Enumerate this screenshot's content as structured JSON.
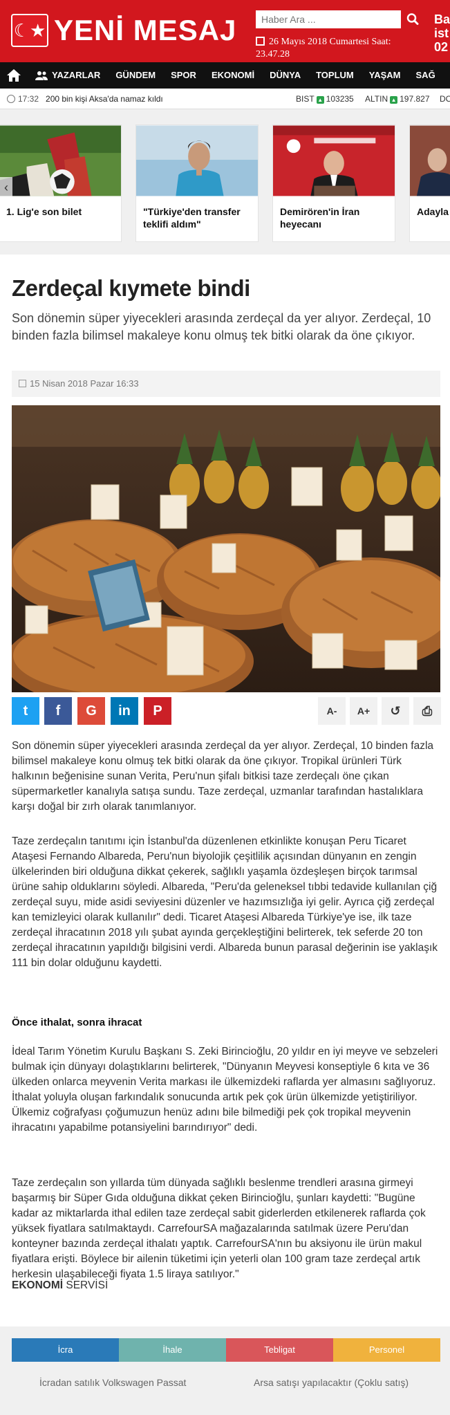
{
  "header": {
    "logo_text": "YENİ MESAJ",
    "search_placeholder": "Haber Ara ...",
    "date": "26 Mayıs 2018 Cumartesi Saat: 23.47.28",
    "weather_top": "Ba",
    "weather_mid": "ist",
    "weather_bot": "02"
  },
  "nav": {
    "items": [
      "YAZARLAR",
      "GÜNDEM",
      "SPOR",
      "EKONOMİ",
      "DÜNYA",
      "TOPLUM",
      "YAŞAM",
      "SAĞ"
    ]
  },
  "ticker": {
    "time": "17:32",
    "headline": "200 bin kişi Aksa'da namaz kıldı",
    "bist_label": "BIST",
    "bist_value": "103235",
    "altin_label": "ALTIN",
    "altin_value": "197.827",
    "dolar_label": "DO"
  },
  "slider": {
    "cards": [
      {
        "caption": "1. Lig'e son bilet"
      },
      {
        "caption": "\"Türkiye'den transfer teklifi aldım\""
      },
      {
        "caption": "Demirören'in İran heyecanı"
      },
      {
        "caption": "Adayla kullan"
      }
    ]
  },
  "article": {
    "title": "Zerdeçal kıymete bindi",
    "lead": "Son dönemin süper yiyecekleri arasında zerdeçal da yer alıyor. Zerdeçal, 10 binden fazla bilimsel makaleye konu olmuş tek bitki olarak da öne çıkıyor.",
    "date": "15 Nisan 2018 Pazar 16:33",
    "share": {
      "twitter": "t",
      "facebook": "f",
      "google": "G",
      "linkedin": "in",
      "pinterest": "P"
    },
    "tools": {
      "font_down": "A-",
      "font_up": "A+",
      "reset": "↺",
      "print": "⎙"
    },
    "p1": "Son dönemin süper yiyecekleri arasında zerdeçal da yer alıyor. Zerdeçal, 10 binden fazla bilimsel makaleye konu olmuş tek bitki olarak da öne çıkıyor. Tropikal ürünleri Türk halkının beğenisine sunan Verita, Peru'nun şifalı bitkisi taze zerdeçalı öne çıkan süpermarketler kanalıyla satışa sundu. Taze zerdeçal, uzmanlar tarafından hastalıklara karşı doğal bir zırh olarak tanımlanıyor.",
    "p2": "Taze zerdeçalın tanıtımı için İstanbul'da düzenlenen etkinlikte konuşan Peru Ticaret Ataşesi Fernando Albareda, Peru'nun biyolojik çeşitlilik açısından dünyanın en zengin ülkelerinden biri olduğuna dikkat çekerek, sağlıklı yaşamla özdeşleşen birçok tarımsal ürüne sahip olduklarını söyledi. Albareda, \"Peru'da geleneksel tıbbi tedavide kullanılan çiğ zerdeçal suyu, mide asidi seviyesini düzenler ve hazımsızlığa iyi gelir. Ayrıca çiğ zerdeçal kan temizleyici olarak kullanılır\" dedi. Ticaret Ataşesi Albareda Türkiye'ye ise, ilk taze zerdeçal ihracatının 2018 yılı şubat ayında gerçekleştiğini belirterek, tek seferde 20 ton zerdeçal ihracatının yapıldığı bilgisini verdi. Albareda bunun parasal değerinin ise yaklaşık 111 bin dolar olduğunu kaydetti.",
    "subheading": "Önce ithalat, sonra ihracat",
    "p3": "İdeal Tarım Yönetim Kurulu Başkanı S. Zeki Birincioğlu, 20 yıldır en iyi meyve ve sebzeleri bulmak için dünyayı dolaştıklarını belirterek, \"Dünyanın Meyvesi konseptiyle 6 kıta ve 36 ülkeden onlarca meyvenin Verita markası ile ülkemizdeki raflarda yer almasını sağlıyoruz. İthalat yoluyla oluşan farkındalık sonucunda artık pek çok ürün ülkemizde yetiştiriliyor. Ülkemiz coğrafyası çoğumuzun henüz adını bile bilmediği pek çok tropikal meyvenin ihracatını yapabilme potansiyelini barındırıyor\" dedi.",
    "p4": "Taze zerdeçalın son yıllarda tüm dünyada sağlıklı beslenme trendleri arasına girmeyi başarmış bir Süper Gıda olduğuna dikkat çeken Birincioğlu, şunları kaydetti: \"Bugüne kadar az miktarlarda ithal edilen taze zerdeçal sabit giderlerden etkilenerek raflarda çok yüksek fiyatlara satılmaktaydı. CarrefourSA mağazalarında satılmak üzere Peru'dan konteyner bazında zerdeçal ithalatı yaptık. CarrefourSA'nın bu aksiyonu ile ürün makul fiyatlara erişti. Böylece bir ailenin tüketimi için yeterli olan 100 gram taze zerdeçal artık herkesin ulaşabileceği fiyata 1.5 liraya satılıyor.\"",
    "source_bold": "EKONOMİ",
    "source_rest": "SERVİSİ"
  },
  "classifieds": {
    "tabs": [
      {
        "label": "İcra",
        "color": "#2a7ab8"
      },
      {
        "label": "İhale",
        "color": "#6fb3ad"
      },
      {
        "label": "Tebligat",
        "color": "#d9565a"
      },
      {
        "label": "Personel",
        "color": "#f0b23d"
      }
    ],
    "item1": "İcradan satılık Volkswagen Passat",
    "item2": "Arsa satışı yapılacaktır (Çoklu satış)"
  }
}
